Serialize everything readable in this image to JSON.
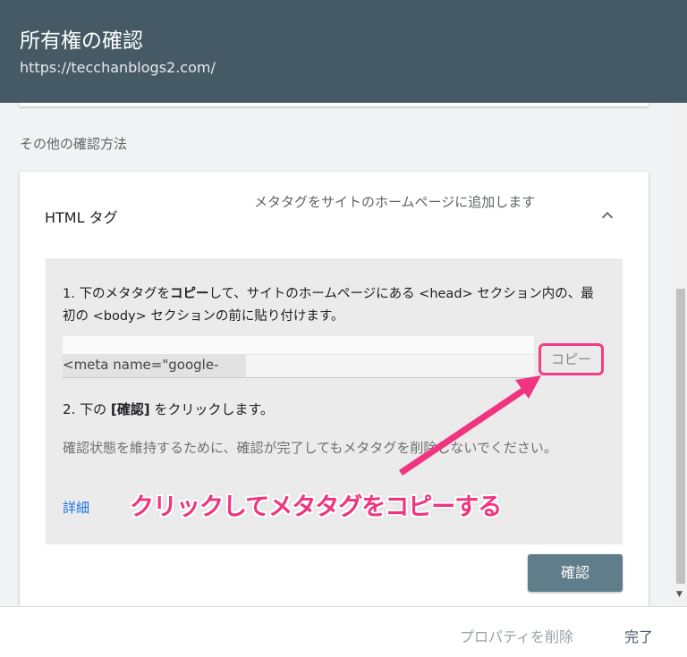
{
  "header": {
    "title": "所有権の確認",
    "url": "https://tecchanblogs2.com/"
  },
  "section_label": "その他の確認方法",
  "html_tag_card": {
    "title": "HTML タグ",
    "description": "メタタグをサイトのホームページに追加します",
    "expand_icon": "chevron-up-icon",
    "step1": {
      "prefix": "1. 下のメタタグを",
      "bold": "コピー",
      "suffix": "して、サイトのホームページにある <head> セクション内の、最初の <body> セクションの前に貼り付けます。"
    },
    "meta_snippet": "<meta name=\"google-",
    "copy_label": "コピー",
    "step2": {
      "prefix": "2. 下の ",
      "bold": "[確認]",
      "suffix": " をクリックします。"
    },
    "note": "確認状態を維持するために、確認が完了してもメタタグを削除しないでください。",
    "detail_link": "詳細",
    "confirm_label": "確認"
  },
  "annotation": {
    "text": "クリックしてメタタグをコピーする",
    "color": "#f0347f"
  },
  "footer": {
    "delete_label": "プロパティを削除",
    "done_label": "完了"
  },
  "colors": {
    "header_bg": "#455a64",
    "link": "#1a73e8",
    "confirm_bg": "#607d8b",
    "highlight": "#f23e83"
  }
}
